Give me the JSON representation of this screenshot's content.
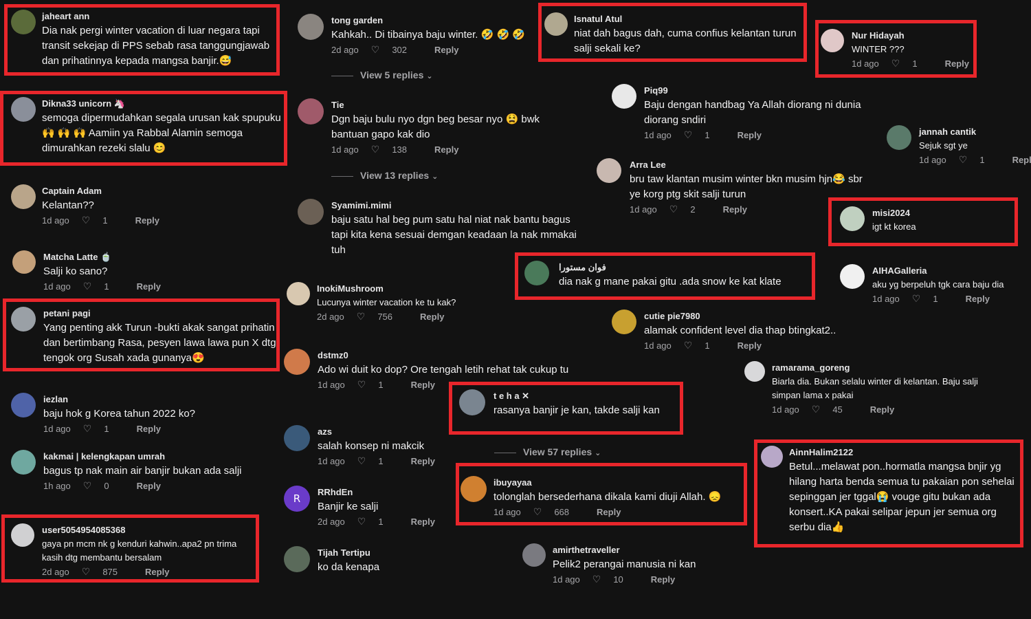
{
  "colors": {
    "background": "#121212",
    "highlight": "#e8262b",
    "text": "#f1f1f2",
    "muted": "#a5a5a8"
  },
  "icons": {
    "heart": "heart-outline-icon",
    "chevron": "chevron-down-icon"
  },
  "ui": {
    "reply_label": "Reply",
    "heart_glyph": "♡",
    "chevron_glyph": "⌄"
  },
  "comments": [
    {
      "user": "jaheart ann",
      "text": "Dia nak pergi winter vacation di luar negara tapi transit sekejap di PPS sebab rasa tanggungjawab dan prihatinnya kepada mangsa banjir.😅",
      "time": "",
      "likes": ""
    },
    {
      "user": "Dikna33 unicorn 🦄",
      "text": "semoga dipermudahkan segala urusan kak spupuku 🙌 🙌 🙌 Aamiin ya Rabbal Alamin semoga dimurahkan rezeki slalu 😊",
      "time": "",
      "likes": ""
    },
    {
      "user": "Captain Adam",
      "text": "Kelantan??",
      "time": "1d ago",
      "likes": "1"
    },
    {
      "user": "Matcha Latte 🍵",
      "text": "Salji ko sano?",
      "time": "1d ago",
      "likes": "1"
    },
    {
      "user": "petani pagi",
      "text": "Yang penting akk Turun -bukti akak sangat prihatin dan bertimbang Rasa, pesyen lawa lawa pun X dtg tengok org Susah xada gunanya😍",
      "time": "",
      "likes": ""
    },
    {
      "user": "iezlan",
      "text": "baju hok g Korea tahun 2022 ko?",
      "time": "1d ago",
      "likes": "1"
    },
    {
      "user": "kakmai | kelengkapan umrah",
      "text": "bagus tp nak main air banjir bukan ada salji",
      "time": "1h ago",
      "likes": "0"
    },
    {
      "user": "user5054954085368",
      "text": "gaya pn mcm nk g kenduri kahwin..apa2 pn trima kasih dtg membantu bersalam",
      "time": "2d ago",
      "likes": "875"
    },
    {
      "user": "tong garden",
      "text": "Kahkah.. Di tibainya baju winter. 🤣 🤣 🤣",
      "time": "2d ago",
      "likes": "302"
    },
    {
      "user": "Tie",
      "text": "Dgn baju bulu nyo dgn beg besar nyo 😫 bwk bantuan gapo kak dio",
      "time": "1d ago",
      "likes": "138"
    },
    {
      "user": "Syamimi.mimi",
      "text": "baju satu hal beg pum satu hal niat nak bantu bagus tapi kita kena sesuai demgan keadaan la nak mmakai tuh",
      "time": "",
      "likes": ""
    },
    {
      "user": "InokiMushroom",
      "text": "Lucunya winter vacation ke tu kak?",
      "time": "2d ago",
      "likes": "756"
    },
    {
      "user": "dstmz0",
      "text": "Ado wi duit ko dop? Ore tengah letih rehat tak cukup tu",
      "time": "1d ago",
      "likes": "1"
    },
    {
      "user": "azs",
      "text": "salah konsep ni makcik",
      "time": "1d ago",
      "likes": "1"
    },
    {
      "user": "RRhdEn",
      "text": "Banjir ke salji",
      "time": "2d ago",
      "likes": "1"
    },
    {
      "user": "Tijah Tertipu",
      "text": "ko da kenapa",
      "time": "",
      "likes": ""
    },
    {
      "user": "Isnatul Atul",
      "text": "niat dah bagus dah, cuma confius kelantan turun salji sekali ke?",
      "time": "",
      "likes": ""
    },
    {
      "user": "Piq99",
      "text": "Baju dengan handbag Ya Allah diorang ni dunia diorang sndiri",
      "time": "1d ago",
      "likes": "1"
    },
    {
      "user": "Arra Lee",
      "text": "bru taw klantan musim winter bkn musim hjn😂 sbr ye korg ptg skit salji turun",
      "time": "1d ago",
      "likes": "2"
    },
    {
      "user": "فوان مستورا",
      "text": "dia nak g mane pakai gitu .ada snow ke kat klate",
      "time": "",
      "likes": ""
    },
    {
      "user": "cutie pie7980",
      "text": "alamak confident level dia thap btingkat2..",
      "time": "1d ago",
      "likes": "1"
    },
    {
      "user": "t e h a ✕",
      "text": "rasanya banjir je kan, takde salji kan",
      "time": "",
      "likes": ""
    },
    {
      "user": "ibuyayaa",
      "text": "tolonglah bersederhana dikala kami diuji Allah. 😞",
      "time": "1d ago",
      "likes": "668"
    },
    {
      "user": "amirthetraveller",
      "text": "Pelik2 perangai manusia ni kan",
      "time": "1d ago",
      "likes": "10"
    },
    {
      "user": "Nur Hidayah",
      "text": "WINTER ???",
      "time": "1d ago",
      "likes": "1"
    },
    {
      "user": "jannah cantik",
      "text": "Sejuk sgt ye",
      "time": "1d ago",
      "likes": "1"
    },
    {
      "user": "misi2024",
      "text": "igt kt korea",
      "time": "",
      "likes": ""
    },
    {
      "user": "AIHAGalleria",
      "text": "aku yg berpeluh tgk cara baju dia",
      "time": "1d ago",
      "likes": "1"
    },
    {
      "user": "ramarama_goreng",
      "text": "Biarla dia. Bukan selalu winter di kelantan. Baju salji simpan lama x pakai",
      "time": "1d ago",
      "likes": "45"
    },
    {
      "user": "AinnHalim2122",
      "text": "Betul...melawat pon..hormatla mangsa bnjir yg hilang harta benda semua tu pakaian pon sehelai sepinggan jer tggal😭 vouge gitu bukan ada konsert..KA pakai selipar jepun jer semua org serbu dia👍",
      "time": "",
      "likes": ""
    }
  ],
  "view_replies": [
    "View 5 replies",
    "View 13 replies",
    "View 57 replies"
  ]
}
